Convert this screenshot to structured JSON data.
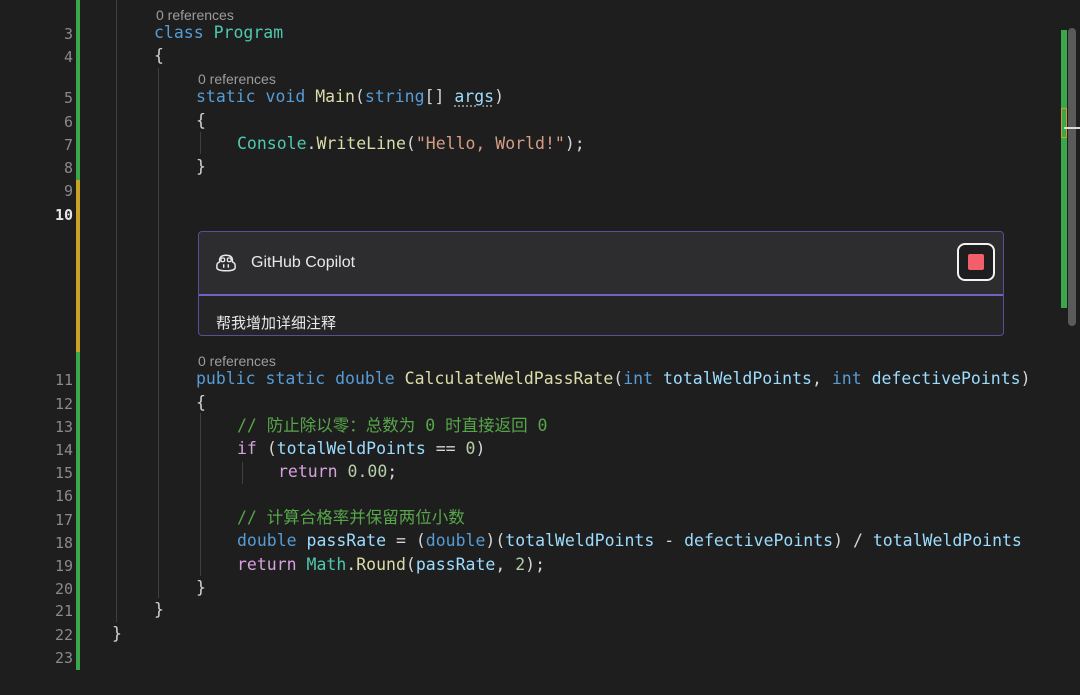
{
  "editor": {
    "line_numbers": [
      "3",
      "4",
      "5",
      "6",
      "7",
      "8",
      "9",
      "10",
      "11",
      "12",
      "13",
      "14",
      "15",
      "16",
      "17",
      "18",
      "19",
      "20",
      "21",
      "22",
      "23"
    ],
    "current_line": "10",
    "codelens": {
      "class_refs": "0 references",
      "main_refs": "0 references",
      "method_refs": "0 references"
    },
    "tokens": {
      "kw_class": "class",
      "type_program": "Program",
      "brace_open": "{",
      "brace_close": "}",
      "kw_static": "static",
      "kw_void": "void",
      "fn_main": "Main",
      "paren_open": "(",
      "kw_string": "string",
      "brackets": "[]",
      "param_args": "args",
      "paren_close": ")",
      "type_console": "Console",
      "dot": ".",
      "fn_writeline": "WriteLine",
      "str_hello": "\"Hello, World!\"",
      "close_semi": ");",
      "kw_public": "public",
      "kw_double": "double",
      "fn_calc": "CalculateWeldPassRate",
      "kw_int": "int",
      "param_total": "totalWeldPoints",
      "comma": ",",
      "param_defective": "defectivePoints",
      "comment_1": "// 防止除以零：总数为 0 时直接返回 0",
      "kw_if": "if",
      "eq_op": "==",
      "num_zero": "0",
      "kw_return": "return",
      "num_zero_dec": "0.00",
      "semi": ";",
      "comment_2": "// 计算合格率并保留两位小数",
      "param_passrate": "passRate",
      "assign_op": "=",
      "minus_op": "-",
      "div_op": "/",
      "type_math": "Math",
      "fn_round": "Round",
      "num_two": "2"
    }
  },
  "copilot": {
    "title": "GitHub Copilot",
    "prompt": "帮我增加详细注释",
    "stop_icon": "stop-square-icon",
    "accent_color": "#6f63c4",
    "stop_color": "#f25f6a"
  },
  "colors": {
    "background": "#1e1e1e",
    "keyword": "#569cd6",
    "type": "#4ec9b0",
    "function": "#dcdcaa",
    "parameter": "#9cdcfe",
    "string": "#d69d85",
    "number": "#b5cea8",
    "comment": "#57a64a",
    "control": "#d8a0df",
    "change_saved": "#3aa84a",
    "change_unsaved": "#c9a227"
  }
}
